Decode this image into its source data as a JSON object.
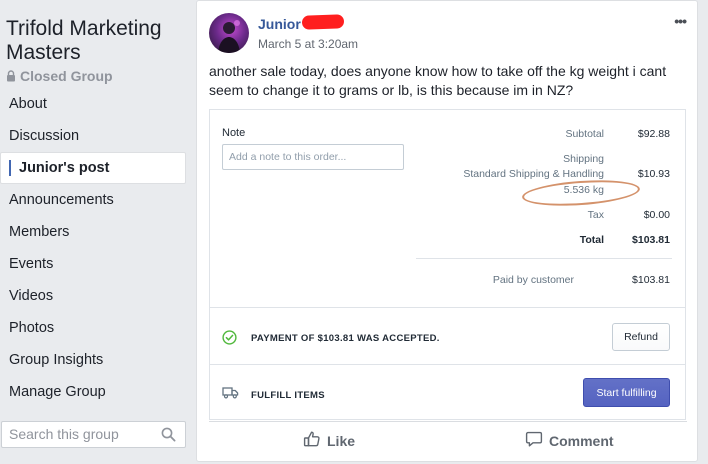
{
  "group": {
    "title": "Trifold Marketing Masters",
    "status": "Closed Group"
  },
  "nav": {
    "items": [
      {
        "label": "About"
      },
      {
        "label": "Discussion"
      },
      {
        "label": "Junior's post"
      },
      {
        "label": "Announcements"
      },
      {
        "label": "Members"
      },
      {
        "label": "Events"
      },
      {
        "label": "Videos"
      },
      {
        "label": "Photos"
      },
      {
        "label": "Group Insights"
      },
      {
        "label": "Manage Group"
      }
    ],
    "active_index": 2
  },
  "search": {
    "placeholder": "Search this group"
  },
  "post": {
    "author": "Junior",
    "timestamp": "March 5 at 3:20am",
    "more": "•••",
    "text": "another sale today, does anyone know how to take off the kg weight i cant seem to change it to grams or lb, is this because im in NZ?"
  },
  "order": {
    "note_label": "Note",
    "note_placeholder": "Add a note to this order...",
    "subtotal_label": "Subtotal",
    "subtotal_value": "$92.88",
    "shipping_label": "Shipping",
    "shipping_method": "Standard Shipping & Handling",
    "shipping_value": "$10.93",
    "weight": "5.536 kg",
    "tax_label": "Tax",
    "tax_value": "$0.00",
    "total_label": "Total",
    "total_value": "$103.81",
    "paid_label": "Paid by customer",
    "paid_value": "$103.81",
    "payment_message": "PAYMENT OF $103.81 WAS ACCEPTED.",
    "refund_label": "Refund",
    "fulfill_label": "FULFILL ITEMS",
    "start_fulfilling_label": "Start fulfilling"
  },
  "actions": {
    "like": "Like",
    "comment": "Comment"
  },
  "colors": {
    "link_blue": "#365899",
    "accent_blue": "#4267b2",
    "shopify_indigo": "#5c6ac4",
    "success_green": "#50b83c",
    "annotation_orange": "#d4926b"
  }
}
